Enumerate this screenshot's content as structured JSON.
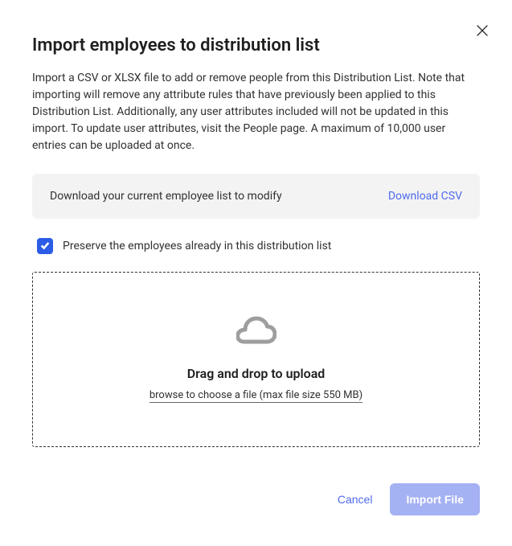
{
  "dialog": {
    "title": "Import employees to distribution list",
    "description": "Import a CSV or XLSX file to add or remove people from this Distribution List. Note that importing will remove any attribute rules that have previously been applied to this Distribution List. Additionally, any user attributes included will not be updated in this import. To update user attributes, visit the People page. A maximum of 10,000 user entries can be uploaded at once."
  },
  "download_panel": {
    "text": "Download your current employee list to modify",
    "link_label": "Download CSV"
  },
  "preserve_checkbox": {
    "checked": true,
    "label": "Preserve the employees already in this distribution list"
  },
  "dropzone": {
    "title": "Drag and drop to upload",
    "subtext": "browse to choose a file (max file size 550 MB)"
  },
  "footer": {
    "cancel_label": "Cancel",
    "import_label": "Import File"
  }
}
